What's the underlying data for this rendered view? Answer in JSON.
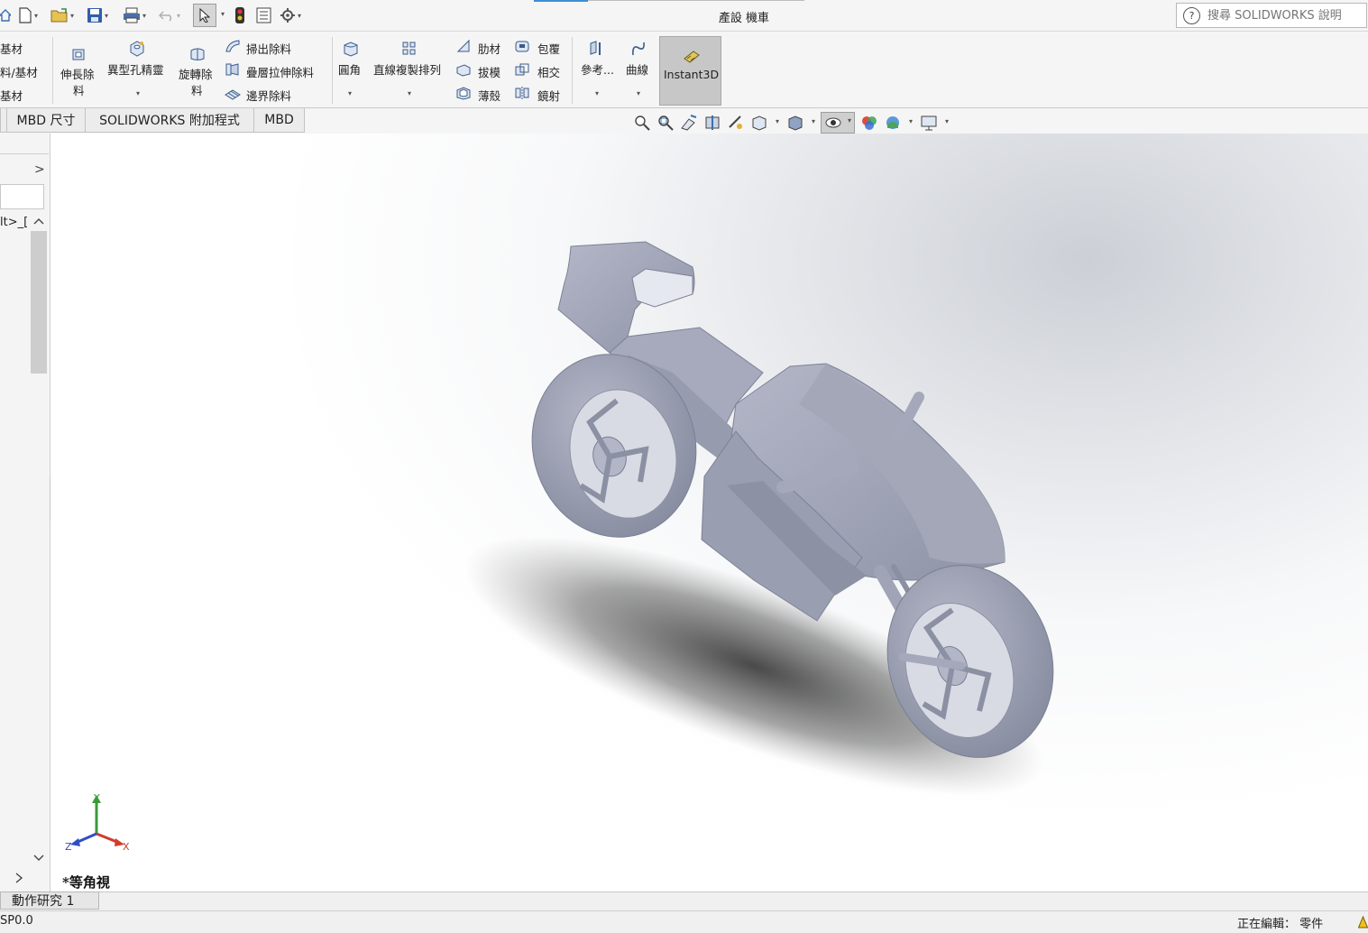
{
  "window": {
    "title": "產設 機車",
    "help_search_placeholder": "搜尋 SOLIDWORKS 說明",
    "help_icon": "?"
  },
  "ribbon": {
    "left_partial": [
      "基材",
      "料/基材",
      "基材"
    ],
    "extrude_cut": [
      "伸長除",
      "料"
    ],
    "hole_wizard": "異型孔精靈",
    "revolve_cut": [
      "旋轉除",
      "料"
    ],
    "swept_cut": "掃出除料",
    "lofted_cut": "疊層拉伸除料",
    "boundary_cut": "邊界除料",
    "fillet": "圓角",
    "linear_pattern": "直線複製排列",
    "rib": "肋材",
    "draft": "拔模",
    "shell": "薄殼",
    "wrap": "包覆",
    "intersect": "相交",
    "mirror": "鏡射",
    "reference": "參考...",
    "curves": "曲線",
    "instant3d": "Instant3D"
  },
  "tabs": [
    "MBD 尺寸",
    "SOLIDWORKS 附加程式",
    "MBD"
  ],
  "left_panel": {
    "tree_item": "lt>_[",
    "expand": ">",
    "collapse_up": "^",
    "collapse_down": "v"
  },
  "viewport": {
    "view_name": "*等角視",
    "triad": {
      "x": "X",
      "y": "Y",
      "z": "Z"
    }
  },
  "motion_tab": "動作研究 1",
  "status": {
    "left": "SP0.0",
    "editing": "正在編輯： 零件"
  },
  "colors": {
    "model": "#a3a7b8",
    "accent": "#3c8fd8",
    "axis_x": "#d23c2a",
    "axis_y": "#3a9a3a",
    "axis_z": "#2f4fc4"
  }
}
